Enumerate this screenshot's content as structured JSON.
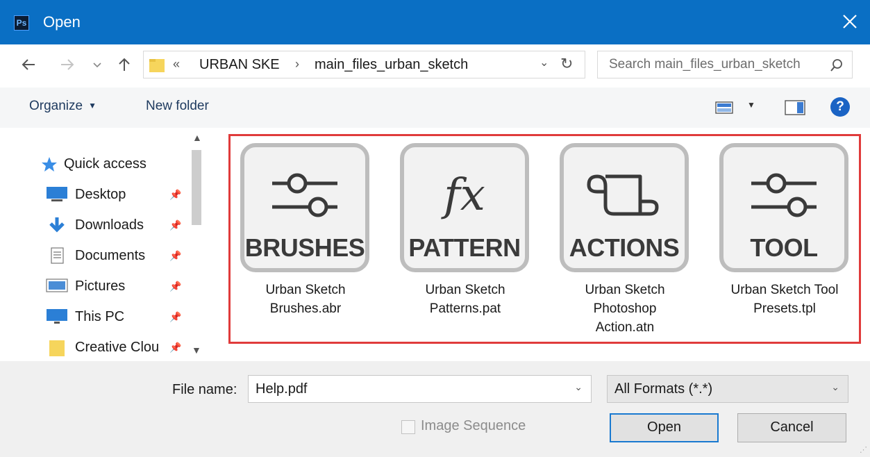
{
  "titlebar": {
    "title": "Open",
    "app_icon_text": "Ps"
  },
  "address": {
    "overflow": "«",
    "crumbs": [
      "URBAN SKE",
      "main_files_urban_sketch"
    ]
  },
  "search": {
    "placeholder": "Search main_files_urban_sketch"
  },
  "toolbar": {
    "organize_label": "Organize",
    "new_folder_label": "New folder",
    "help_label": "?"
  },
  "sidebar": {
    "items": [
      {
        "label": "Quick access",
        "icon": "star-icon"
      },
      {
        "label": "Desktop",
        "icon": "desktop-icon",
        "pinned": true
      },
      {
        "label": "Downloads",
        "icon": "download-icon",
        "pinned": true
      },
      {
        "label": "Documents",
        "icon": "documents-icon",
        "pinned": true
      },
      {
        "label": "Pictures",
        "icon": "pictures-icon",
        "pinned": true
      },
      {
        "label": "This PC",
        "icon": "computer-icon",
        "pinned": true
      },
      {
        "label": "Creative Clou",
        "icon": "folder-icon",
        "pinned": true
      }
    ]
  },
  "files": [
    {
      "tile_text": "BRUSHES",
      "glyph": "sliders-icon",
      "name_line1": "Urban Sketch",
      "name_line2": "Brushes.abr",
      "name_line3": ""
    },
    {
      "tile_text": "PATTERN",
      "glyph": "fx-icon",
      "glyph_text": "fx",
      "name_line1": "Urban Sketch",
      "name_line2": "Patterns.pat",
      "name_line3": ""
    },
    {
      "tile_text": "ACTIONS",
      "glyph": "scroll-icon",
      "name_line1": "Urban Sketch",
      "name_line2": "Photoshop",
      "name_line3": "Action.atn"
    },
    {
      "tile_text": "TOOL",
      "glyph": "sliders-icon",
      "name_line1": "Urban Sketch Tool",
      "name_line2": "Presets.tpl",
      "name_line3": ""
    }
  ],
  "bottom": {
    "file_name_label": "File name:",
    "file_name_value": "Help.pdf",
    "format_value": "All Formats (*.*)",
    "image_sequence_label": "Image Sequence",
    "open_label": "Open",
    "cancel_label": "Cancel"
  },
  "colors": {
    "titlebar": "#0a6fc4",
    "highlight": "#e03b3b",
    "accent": "#1979d0"
  }
}
